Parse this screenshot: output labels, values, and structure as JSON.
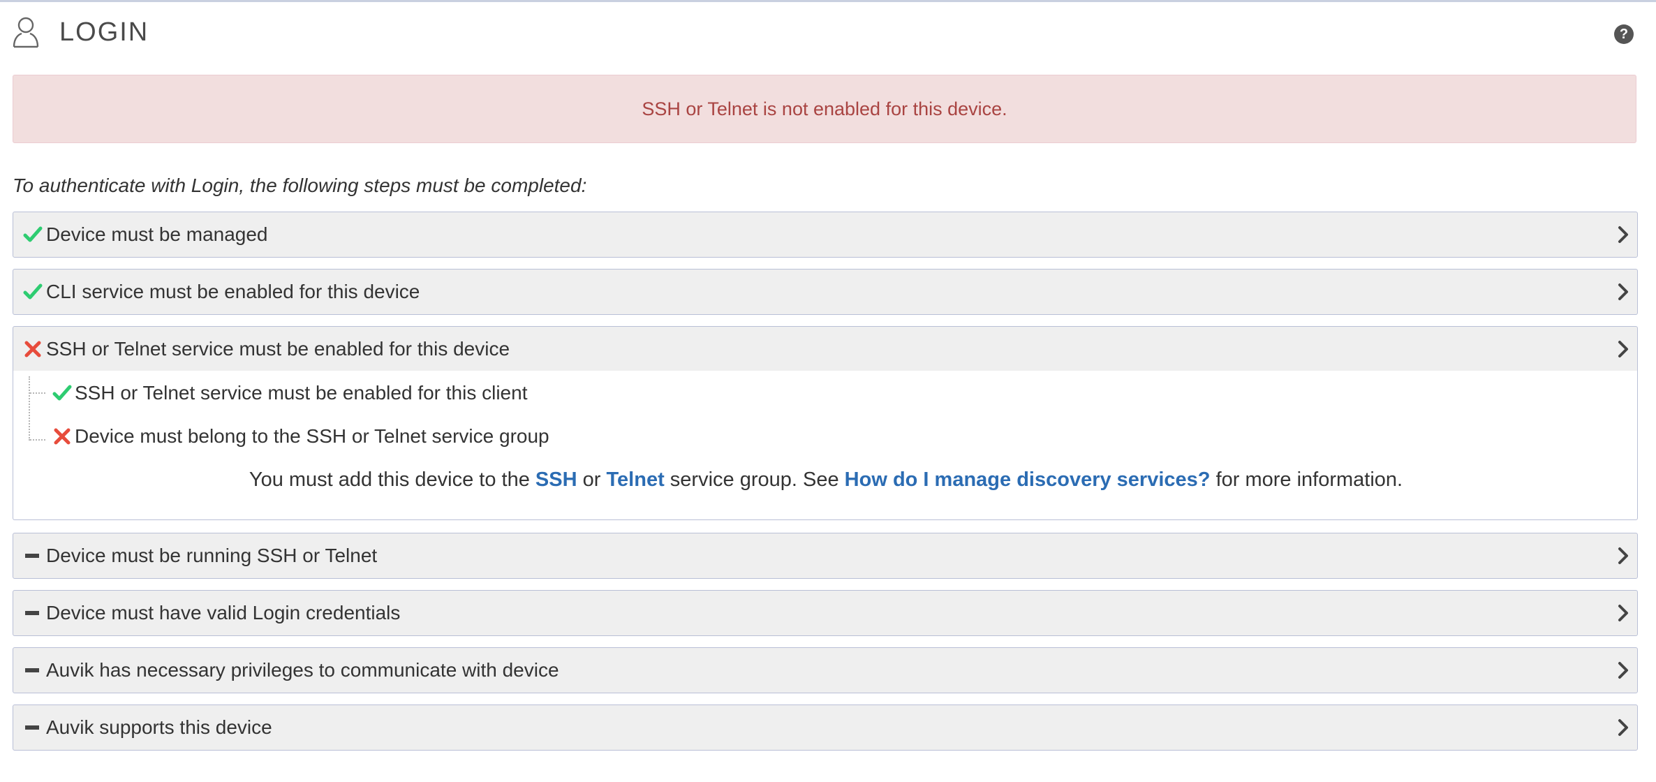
{
  "header": {
    "title": "LOGIN",
    "help_icon": "question-circle-icon",
    "help_label": "?"
  },
  "alert": {
    "message": "SSH or Telnet is not enabled for this device."
  },
  "intro": "To authenticate with Login, the following steps must be completed:",
  "colors": {
    "check": "#2ecc71",
    "cross": "#e74c3c",
    "dash": "#444444",
    "link": "#2b6cb3",
    "alert_text": "#a94442",
    "alert_bg": "#f2dede"
  },
  "steps": [
    {
      "status": "check",
      "label": "Device must be managed"
    },
    {
      "status": "check",
      "label": "CLI service must be enabled for this device"
    },
    {
      "status": "cross",
      "label": "SSH or Telnet service must be enabled for this device",
      "expanded": true
    },
    {
      "status": "dash",
      "label": "Device must be running SSH or Telnet"
    },
    {
      "status": "dash",
      "label": "Device must have valid Login credentials"
    },
    {
      "status": "dash",
      "label": "Auvik has necessary privileges to communicate with device"
    },
    {
      "status": "dash",
      "label": "Auvik supports this device"
    }
  ],
  "substeps": [
    {
      "status": "check",
      "label": "SSH or Telnet service must be enabled for this client"
    },
    {
      "status": "cross",
      "label": "Device must belong to the SSH or Telnet service group"
    }
  ],
  "info": {
    "prefix": "You must add this device to the",
    "link_ssh": "SSH",
    "or": "or",
    "link_telnet": "Telnet",
    "middle": "service group. See",
    "link_help": "How do I manage discovery services?",
    "suffix": "for more information."
  }
}
